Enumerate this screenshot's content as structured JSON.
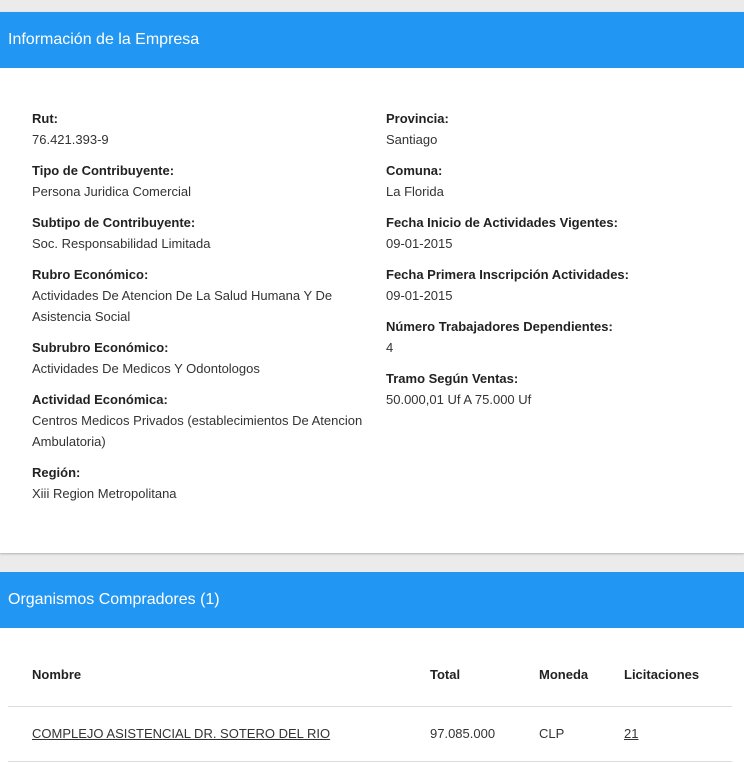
{
  "company": {
    "title": "Información de la Empresa",
    "left_fields": [
      {
        "label": "Rut:",
        "value": "76.421.393-9"
      },
      {
        "label": "Tipo de Contribuyente:",
        "value": "Persona Juridica Comercial"
      },
      {
        "label": "Subtipo de Contribuyente:",
        "value": "Soc. Responsabilidad Limitada"
      },
      {
        "label": "Rubro Económico:",
        "value": "Actividades De Atencion De La Salud Humana Y De Asistencia Social"
      },
      {
        "label": "Subrubro Económico:",
        "value": "Actividades De Medicos Y Odontologos"
      },
      {
        "label": "Actividad Económica:",
        "value": "Centros Medicos Privados (establecimientos De Atencion Ambulatoria)"
      },
      {
        "label": "Región:",
        "value": "Xiii Region Metropolitana"
      }
    ],
    "right_fields": [
      {
        "label": "Provincia:",
        "value": "Santiago"
      },
      {
        "label": "Comuna:",
        "value": "La Florida"
      },
      {
        "label": "Fecha Inicio de Actividades Vigentes:",
        "value": "09-01-2015"
      },
      {
        "label": "Fecha Primera Inscripción Actividades:",
        "value": "09-01-2015"
      },
      {
        "label": "Número Trabajadores Dependientes:",
        "value": "4"
      },
      {
        "label": "Tramo Según Ventas:",
        "value": "50.000,01 Uf A 75.000 Uf"
      }
    ]
  },
  "buyers": {
    "title": "Organismos Compradores (1)",
    "columns": {
      "name": "Nombre",
      "total": "Total",
      "currency": "Moneda",
      "bids": "Licitaciones"
    },
    "rows": [
      {
        "name": "COMPLEJO ASISTENCIAL DR. SOTERO DEL RIO",
        "total": "97.085.000",
        "currency": "CLP",
        "bids": "21"
      }
    ]
  },
  "colors": {
    "header_blue": "#2196f3"
  }
}
